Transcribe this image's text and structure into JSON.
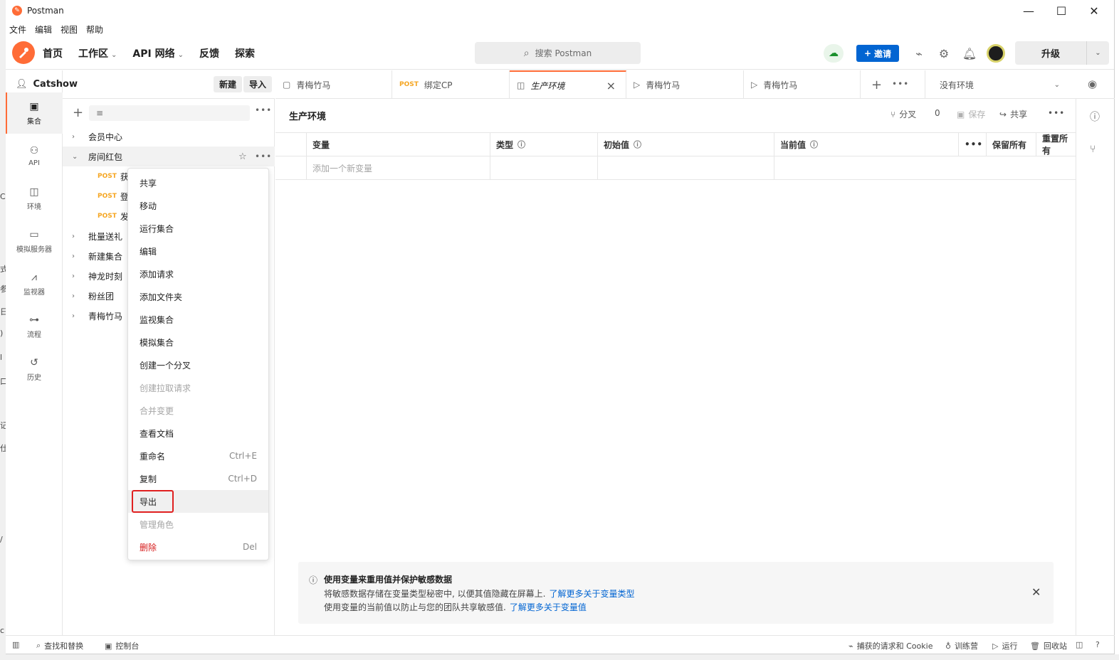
{
  "window": {
    "title": "Postman"
  },
  "menubar": [
    "文件",
    "编辑",
    "视图",
    "帮助"
  ],
  "header": {
    "nav": [
      {
        "label": "首页",
        "dropdown": false
      },
      {
        "label": "工作区",
        "dropdown": true
      },
      {
        "label": "API 网络",
        "dropdown": true
      },
      {
        "label": "反馈",
        "dropdown": false
      },
      {
        "label": "探索",
        "dropdown": false
      }
    ],
    "search_placeholder": "搜索 Postman",
    "invite_label": "邀请",
    "upgrade_label": "升级"
  },
  "workspace": {
    "user": "Catshow",
    "new_label": "新建",
    "import_label": "导入"
  },
  "rail": [
    {
      "label": "集合",
      "icon": "collections-icon",
      "active": true
    },
    {
      "label": "API",
      "icon": "api-icon",
      "active": false
    },
    {
      "label": "环境",
      "icon": "environment-icon",
      "active": false
    },
    {
      "label": "模拟服务器",
      "icon": "mock-server-icon",
      "active": false
    },
    {
      "label": "监视器",
      "icon": "monitor-icon",
      "active": false
    },
    {
      "label": "流程",
      "icon": "flows-icon",
      "active": false
    },
    {
      "label": "历史",
      "icon": "history-icon",
      "active": false
    }
  ],
  "tree": {
    "collections": [
      {
        "name": "会员中心",
        "expanded": false
      },
      {
        "name": "房间红包",
        "expanded": true
      },
      {
        "name": "批量送礼",
        "expanded": false
      },
      {
        "name": "新建集合",
        "expanded": false
      },
      {
        "name": "神龙时刻",
        "expanded": false
      },
      {
        "name": "粉丝团",
        "expanded": false
      },
      {
        "name": "青梅竹马",
        "expanded": false
      }
    ],
    "requests": [
      {
        "method": "POST",
        "name": "获"
      },
      {
        "method": "POST",
        "name": "登"
      },
      {
        "method": "POST",
        "name": "发"
      }
    ]
  },
  "context_menu": [
    {
      "label": "共享",
      "shortcut": "",
      "disabled": false
    },
    {
      "label": "移动",
      "shortcut": "",
      "disabled": false
    },
    {
      "label": "运行集合",
      "shortcut": "",
      "disabled": false
    },
    {
      "label": "编辑",
      "shortcut": "",
      "disabled": false
    },
    {
      "label": "添加请求",
      "shortcut": "",
      "disabled": false
    },
    {
      "label": "添加文件夹",
      "shortcut": "",
      "disabled": false
    },
    {
      "label": "监视集合",
      "shortcut": "",
      "disabled": false
    },
    {
      "label": "模拟集合",
      "shortcut": "",
      "disabled": false
    },
    {
      "label": "创建一个分叉",
      "shortcut": "",
      "disabled": false
    },
    {
      "label": "创建拉取请求",
      "shortcut": "",
      "disabled": true
    },
    {
      "label": "合并变更",
      "shortcut": "",
      "disabled": true
    },
    {
      "label": "查看文档",
      "shortcut": "",
      "disabled": false
    },
    {
      "label": "重命名",
      "shortcut": "Ctrl+E",
      "disabled": false
    },
    {
      "label": "复制",
      "shortcut": "Ctrl+D",
      "disabled": false
    },
    {
      "label": "导出",
      "shortcut": "",
      "disabled": false
    },
    {
      "label": "管理角色",
      "shortcut": "",
      "disabled": true
    },
    {
      "label": "删除",
      "shortcut": "Del",
      "disabled": false
    }
  ],
  "tabs": [
    {
      "label": "青梅竹马",
      "method": "",
      "active": false
    },
    {
      "label": "绑定CP",
      "method": "POST",
      "active": false
    },
    {
      "label": "生产环境",
      "method": "",
      "active": true
    },
    {
      "label": "青梅竹马",
      "method": "",
      "active": false
    },
    {
      "label": "青梅竹马",
      "method": "",
      "active": false
    }
  ],
  "environment_selector": "没有环境",
  "env": {
    "title": "生产环境",
    "fork_label": "分叉",
    "fork_count": "0",
    "save_label": "保存",
    "share_label": "共享",
    "columns": [
      "变量",
      "类型",
      "初始值",
      "当前值"
    ],
    "persist_all": "保留所有",
    "reset_all": "重置所有",
    "add_placeholder": "添加一个新变量"
  },
  "banner": {
    "title": "使用变量来重用值并保护敏感数据",
    "line1": "将敏感数据存储在变量类型秘密中, 以便其值隐藏在屏幕上.",
    "link1": "了解更多关于变量类型",
    "line2": "使用变量的当前值以防止与您的团队共享敏感值.",
    "link2": "了解更多关于变量值"
  },
  "statusbar": {
    "find_replace": "查找和替换",
    "console": "控制台",
    "capture": "捕获的请求和 Cookie",
    "bootcamp": "训练营",
    "runner": "运行",
    "trash": "回收站"
  },
  "colors": {
    "brand": "#ff6c37",
    "primary": "#0265d2",
    "danger": "#d61c1c",
    "highlight_border": "#e02020"
  }
}
